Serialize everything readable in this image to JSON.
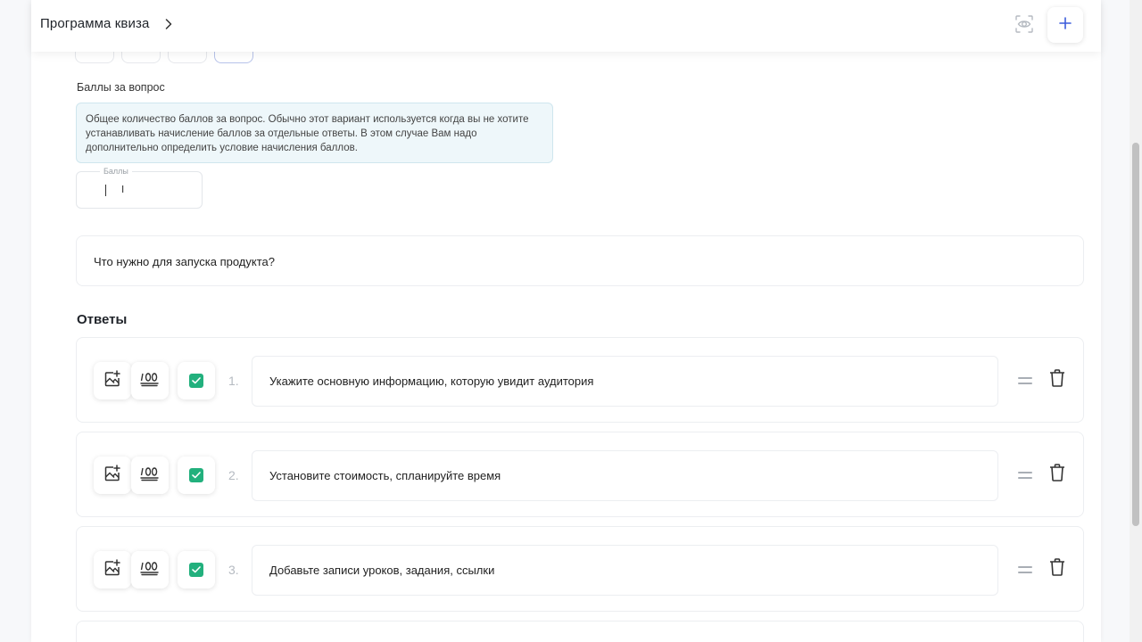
{
  "header": {
    "title": "Программа квиза",
    "chevron_icon": "chevron-right-icon",
    "preview_icon": "eye-icon",
    "add_icon": "plus-icon"
  },
  "score": {
    "label": "Баллы за вопрос",
    "info": "Общее количество баллов за вопрос. Обычно этот вариант используется когда вы не хотите устанавливать начисление баллов за отдельные ответы. В этом случае Вам надо дополнительно определить условие начисления баллов.",
    "field_label": "Баллы",
    "value": ""
  },
  "question": {
    "text": "Что нужно для запуска продукта?"
  },
  "answers": {
    "heading": "Ответы",
    "items": [
      {
        "number": "1.",
        "text": "Укажите основную информацию, которую увидит аудитория",
        "correct": true
      },
      {
        "number": "2.",
        "text": "Установите стоимость, спланируйте время",
        "correct": true
      },
      {
        "number": "3.",
        "text": "Добавьте записи уроков, задания, ссылки",
        "correct": true
      }
    ]
  },
  "colors": {
    "accent": "#3b5bdb",
    "check_green": "#22b07d",
    "info_bg": "#eef7fa"
  }
}
